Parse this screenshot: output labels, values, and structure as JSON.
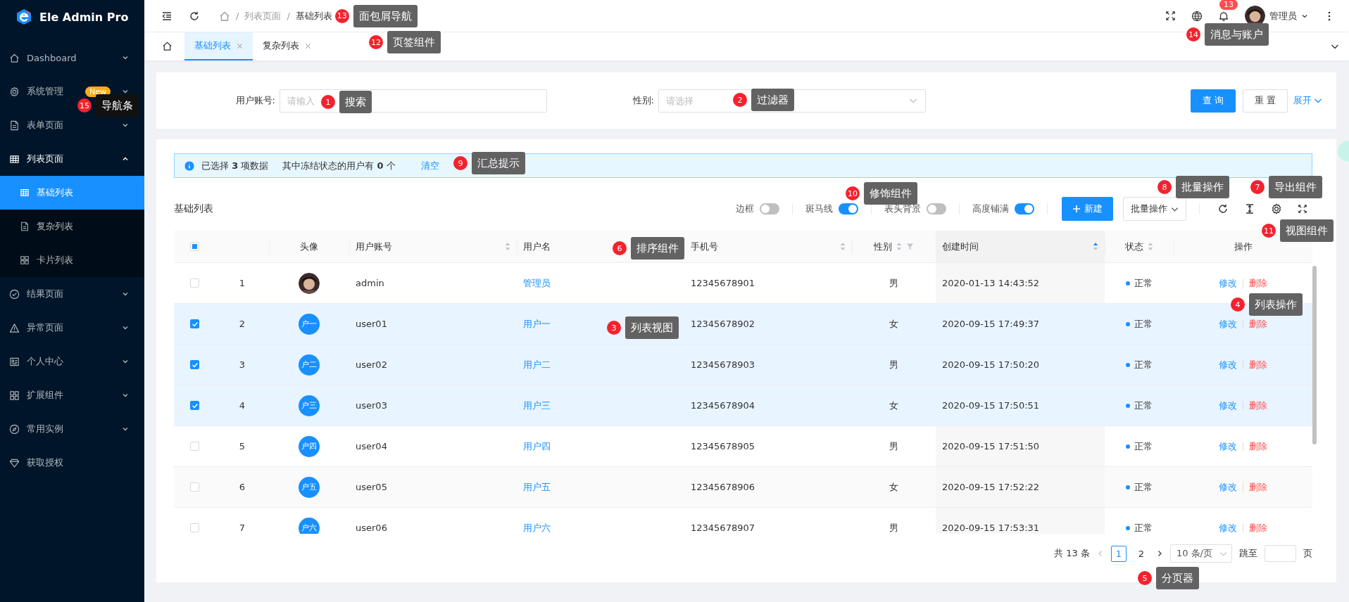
{
  "sidebar": {
    "logo": "Ele Admin Pro",
    "items": [
      {
        "label": "Dashboard",
        "kind": "submenu",
        "expanded": false
      },
      {
        "label": "系统管理",
        "kind": "submenu",
        "expanded": false,
        "badge": "New"
      },
      {
        "label": "表单页面",
        "kind": "submenu",
        "expanded": false
      },
      {
        "label": "列表页面",
        "kind": "submenu",
        "expanded": true,
        "children": [
          {
            "label": "基础列表",
            "selected": true
          },
          {
            "label": "复杂列表",
            "selected": false
          },
          {
            "label": "卡片列表",
            "selected": false
          }
        ]
      },
      {
        "label": "结果页面",
        "kind": "submenu",
        "expanded": false
      },
      {
        "label": "异常页面",
        "kind": "submenu",
        "expanded": false
      },
      {
        "label": "个人中心",
        "kind": "submenu",
        "expanded": false
      },
      {
        "label": "扩展组件",
        "kind": "submenu",
        "expanded": false
      },
      {
        "label": "常用实例",
        "kind": "submenu",
        "expanded": false
      },
      {
        "label": "获取授权",
        "kind": "link"
      }
    ]
  },
  "header": {
    "breadcrumb": [
      {
        "kind": "home"
      },
      {
        "kind": "separator",
        "text": "/"
      },
      {
        "kind": "link",
        "text": "列表页面"
      },
      {
        "kind": "separator",
        "text": "/"
      },
      {
        "kind": "current",
        "text": "基础列表"
      }
    ],
    "notification_count": "13",
    "user": "管理员"
  },
  "tabs": [
    {
      "kind": "home",
      "selected": false
    },
    {
      "kind": "page",
      "label": "基础列表",
      "selected": true
    },
    {
      "kind": "page",
      "label": "复杂列表",
      "selected": false
    }
  ],
  "search": {
    "fields": [
      {
        "kind": "input",
        "label": "用户账号:",
        "placeholder": "请输入"
      },
      {
        "kind": "select",
        "label": "性别:",
        "placeholder": "请选择"
      }
    ],
    "buttons": [
      {
        "kind": "primary",
        "label": "查 询"
      },
      {
        "kind": "default",
        "label": "重 置"
      }
    ],
    "expand": "展开"
  },
  "summary": {
    "selected_text": "已选择 **3** 项数据",
    "frozen_text": "其中冻结状态的用户有 **0** 个",
    "clear": "清空"
  },
  "toolbar": {
    "title": "基础列表",
    "switches": [
      {
        "label": "边框",
        "on": false
      },
      {
        "label": "斑马线",
        "on": true
      },
      {
        "label": "表头背景",
        "on": false
      },
      {
        "label": "高度铺满",
        "on": true
      }
    ],
    "create": "新建",
    "batch": "批量操作"
  },
  "table": {
    "select_all": {
      "indeterminate": true
    },
    "columns": [
      {
        "label": "头像"
      },
      {
        "label": "用户账号",
        "sortable": true,
        "sorted_ascending": false
      },
      {
        "label": "用户名"
      },
      {
        "label": "手机号",
        "sortable": true,
        "sorted_ascending": false
      },
      {
        "label": "性别",
        "sortable": true,
        "sorted_ascending": false,
        "filter": true
      },
      {
        "label": "创建时间",
        "sortable": true,
        "sorted_ascending": true
      },
      {
        "label": "状态",
        "sortable": true,
        "sorted_ascending": false
      },
      {
        "label": "操作"
      }
    ],
    "rows": [
      {
        "index": "1",
        "avatar": {
          "kind": "picture"
        },
        "account": "admin",
        "name": "管理员",
        "phone": "12345678901",
        "gender": "男",
        "created": "2020-01-13 14:43:52",
        "status": "正常",
        "actions": [
          "修改",
          "删除"
        ],
        "selected": false
      },
      {
        "index": "2",
        "avatar": {
          "kind": "text",
          "text": "户一"
        },
        "account": "user01",
        "name": "用户一",
        "phone": "12345678902",
        "gender": "女",
        "created": "2020-09-15 17:49:37",
        "status": "正常",
        "actions": [
          "修改",
          "删除"
        ],
        "selected": true
      },
      {
        "index": "3",
        "avatar": {
          "kind": "text",
          "text": "户二"
        },
        "account": "user02",
        "name": "用户二",
        "phone": "12345678903",
        "gender": "男",
        "created": "2020-09-15 17:50:20",
        "status": "正常",
        "actions": [
          "修改",
          "删除"
        ],
        "selected": true
      },
      {
        "index": "4",
        "avatar": {
          "kind": "text",
          "text": "户三"
        },
        "account": "user03",
        "name": "用户三",
        "phone": "12345678904",
        "gender": "女",
        "created": "2020-09-15 17:50:51",
        "status": "正常",
        "actions": [
          "修改",
          "删除"
        ],
        "selected": true
      },
      {
        "index": "5",
        "avatar": {
          "kind": "text",
          "text": "户四"
        },
        "account": "user04",
        "name": "用户四",
        "phone": "12345678905",
        "gender": "男",
        "created": "2020-09-15 17:51:50",
        "status": "正常",
        "actions": [
          "修改",
          "删除"
        ],
        "selected": false
      },
      {
        "index": "6",
        "avatar": {
          "kind": "text",
          "text": "户五"
        },
        "account": "user05",
        "name": "用户五",
        "phone": "12345678906",
        "gender": "女",
        "created": "2020-09-15 17:52:22",
        "status": "正常",
        "actions": [
          "修改",
          "删除"
        ],
        "selected": false
      },
      {
        "index": "7",
        "avatar": {
          "kind": "text",
          "text": "户六"
        },
        "account": "user06",
        "name": "用户六",
        "phone": "12345678907",
        "gender": "男",
        "created": "2020-09-15 17:53:31",
        "status": "正常",
        "actions": [
          "修改",
          "删除"
        ],
        "selected": false
      }
    ]
  },
  "pagination": {
    "total": "共 13 条",
    "pages": [
      {
        "label": "1",
        "selected": true
      },
      {
        "label": "2",
        "selected": false
      }
    ],
    "page_size": "10 条/页",
    "jump_label": "跳至",
    "jump_suffix": "页"
  },
  "annotations": [
    {
      "number": "13",
      "label": "面包屑导航"
    },
    {
      "number": "14",
      "label": "消息与账户"
    },
    {
      "number": "12",
      "label": "页签组件"
    },
    {
      "number": "15",
      "label": "导航条"
    },
    {
      "number": "1",
      "label": "搜索"
    },
    {
      "number": "2",
      "label": "过滤器"
    },
    {
      "number": "9",
      "label": "汇总提示"
    },
    {
      "number": "10",
      "label": "修饰组件"
    },
    {
      "number": "8",
      "label": "批量操作"
    },
    {
      "number": "7",
      "label": "导出组件"
    },
    {
      "number": "11",
      "label": "视图组件"
    },
    {
      "number": "6",
      "label": "排序组件"
    },
    {
      "number": "4",
      "label": "列表操作"
    },
    {
      "number": "3",
      "label": "列表视图"
    },
    {
      "number": "5",
      "label": "分页器"
    }
  ]
}
